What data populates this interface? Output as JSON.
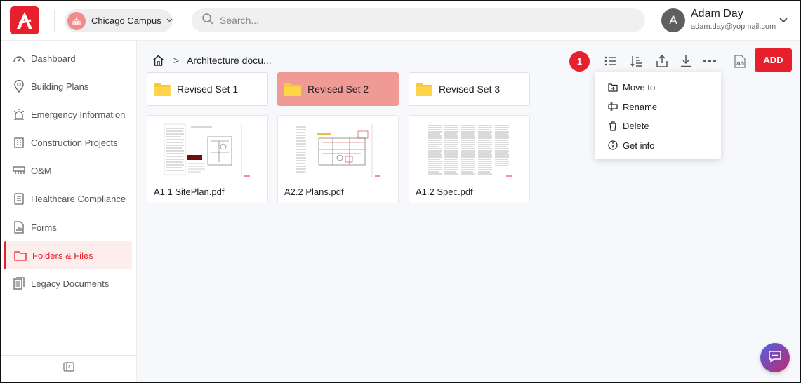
{
  "header": {
    "campus": "Chicago Campus",
    "search_placeholder": "Search...",
    "user_initial": "A",
    "user_name": "Adam Day",
    "user_email": "adam.day@yopmail.com"
  },
  "sidebar": {
    "items": [
      {
        "label": "Dashboard",
        "icon": "dashboard-icon"
      },
      {
        "label": "Building Plans",
        "icon": "location-pin-icon"
      },
      {
        "label": "Emergency Information",
        "icon": "alarm-icon"
      },
      {
        "label": "Construction Projects",
        "icon": "building-icon"
      },
      {
        "label": "O&M",
        "icon": "tools-icon"
      },
      {
        "label": "Healthcare Compliance",
        "icon": "clipboard-icon"
      },
      {
        "label": "Forms",
        "icon": "form-icon"
      },
      {
        "label": "Folders & Files",
        "icon": "folder-icon",
        "active": true
      },
      {
        "label": "Legacy Documents",
        "icon": "documents-icon"
      }
    ]
  },
  "breadcrumb": {
    "separator": ">",
    "current": "Architecture docu..."
  },
  "toolbar": {
    "selected_count": "1",
    "add_label": "ADD"
  },
  "folders": [
    {
      "name": "Revised Set 1",
      "selected": false
    },
    {
      "name": "Revised Set 2",
      "selected": true
    },
    {
      "name": "Revised Set 3",
      "selected": false
    }
  ],
  "files": [
    {
      "name": "A1.1 SitePlan.pdf"
    },
    {
      "name": "A2.2 Plans.pdf"
    },
    {
      "name": "A1.2 Spec.pdf"
    }
  ],
  "context_menu": {
    "items": [
      "Move to",
      "Rename",
      "Delete",
      "Get info"
    ]
  },
  "colors": {
    "accent": "#e8202e",
    "selected_folder": "#ef9a94",
    "folder_yellow": "#f5c518"
  }
}
